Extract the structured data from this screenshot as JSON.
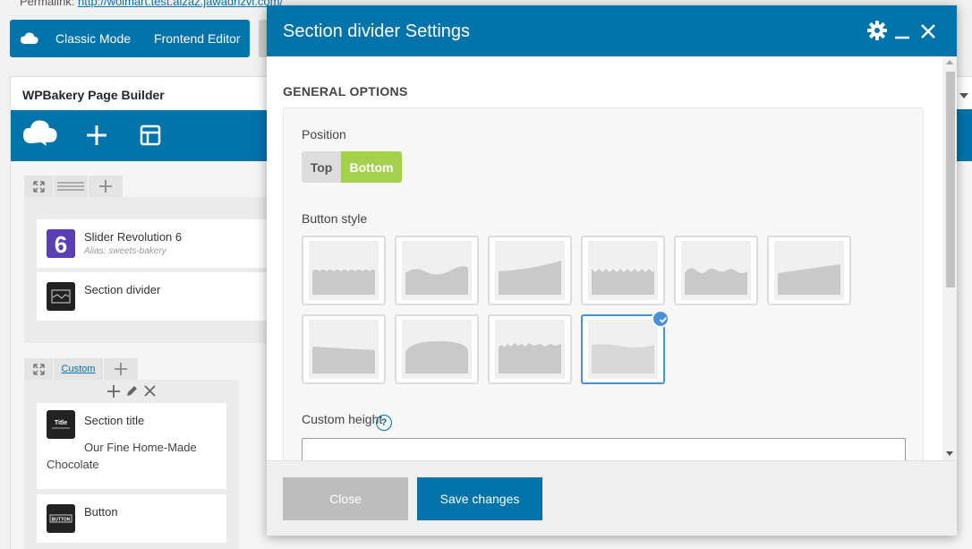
{
  "page": {
    "permalink_label": "Permalink:",
    "permalink_url": "http://wolmart.test.aizaz.jawadrizvi.com/"
  },
  "mode_bar": {
    "classic_label": "Classic Mode",
    "frontend_label": "Frontend Editor"
  },
  "builder": {
    "title": "WPBakery Page Builder",
    "row1": {
      "elements": [
        {
          "title": "Slider Revolution 6",
          "subtitle": "Alias: sweets-bakery",
          "icon": "slider-revolution-icon"
        },
        {
          "title": "Section divider",
          "icon": "section-divider-icon"
        }
      ]
    },
    "row2": {
      "custom_label": "Custom",
      "elements": [
        {
          "title": "Section title",
          "text": "Our Fine Home-Made Chocolate",
          "icon_text": "Title"
        },
        {
          "title": "Button",
          "icon_text": "BUTTON"
        }
      ]
    }
  },
  "modal": {
    "title": "Section divider Settings",
    "section_title": "GENERAL OPTIONS",
    "position": {
      "label": "Position",
      "options": [
        "Top",
        "Bottom"
      ],
      "selected": "Bottom"
    },
    "button_style": {
      "label": "Button style",
      "styles": [
        "waves-small",
        "hill-wave",
        "slope-curve",
        "zigzag",
        "bumps",
        "slope-up",
        "slope-down",
        "arch",
        "rough-top",
        "soft-wave"
      ],
      "selected_index": 9
    },
    "custom_height": {
      "label": "Custom height",
      "help": "?",
      "value": ""
    },
    "footer": {
      "close_label": "Close",
      "save_label": "Save changes"
    }
  },
  "colors": {
    "primary": "#0073aa",
    "active_option": "#a3d14c",
    "selected_border": "#4a90d9",
    "close_button": "#bdbdbd"
  }
}
